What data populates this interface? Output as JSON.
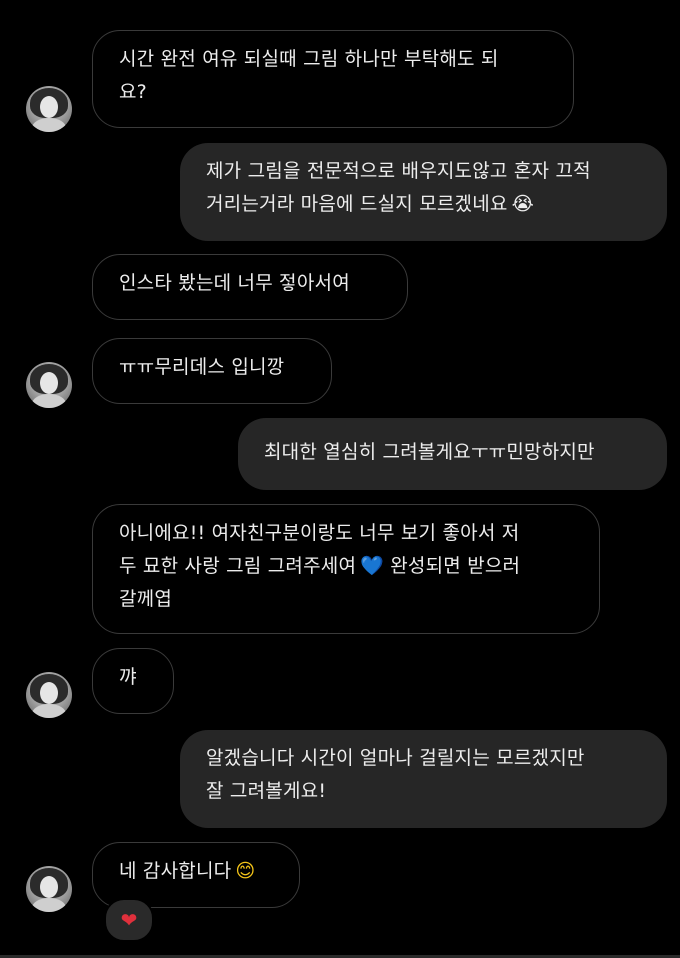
{
  "messages": [
    {
      "dir": "in",
      "lines": [
        "시간 완전 여유 되실때 그림 하나만 부탁해도 되",
        "요?"
      ]
    },
    {
      "dir": "out",
      "lines": [
        "제가 그림을 전문적으로 배우지도않고 혼자 끄적",
        "거리는거라 마음에 드실지 모르겠네요"
      ],
      "emoji": "😭"
    },
    {
      "dir": "in",
      "lines": [
        "인스타 봤는데 너무 젛아서여"
      ]
    },
    {
      "dir": "in",
      "lines": [
        "ㅠㅠ무리데스 입니깡"
      ]
    },
    {
      "dir": "out",
      "lines": [
        "최대한 열심히 그려볼게요ㅜㅠ민망하지만"
      ]
    },
    {
      "dir": "in",
      "lines": [
        "아니에요!! 여자친구분이랑도 너무 보기 좋아서 저",
        "두 묘한 사랑 그림 그려주세여",
        "갈께엽"
      ],
      "emoji": "💙",
      "emoji_line": 1,
      "after_emoji": "완성되면 받으러"
    },
    {
      "dir": "in",
      "lines": [
        "꺄"
      ]
    },
    {
      "dir": "out",
      "lines": [
        "알겠습니다 시간이 얼마나 걸릴지는 모르겠지만",
        "잘 그려볼게요!"
      ]
    },
    {
      "dir": "in",
      "lines": [
        "네 감사합니다"
      ],
      "emoji": "😊"
    }
  ],
  "reaction": {
    "emoji": "❤"
  },
  "avatar": {
    "icon": "profile-avatar"
  }
}
